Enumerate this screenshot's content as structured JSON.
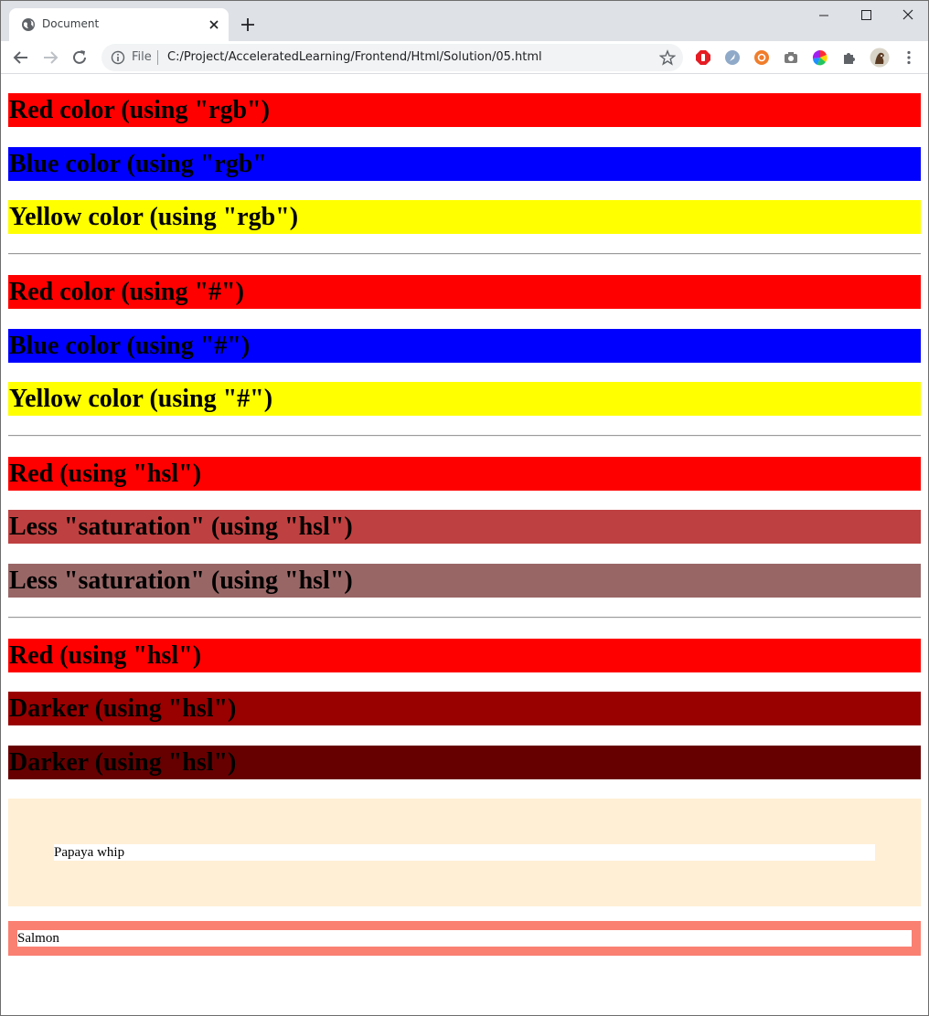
{
  "browser": {
    "tab_title": "Document",
    "url_scheme": "File",
    "url": "C:/Project/AcceleratedLearning/Frontend/Html/Solution/05.html"
  },
  "sections": {
    "rgb": [
      {
        "label": "Red color (using \"rgb\")",
        "color": "#ff0000"
      },
      {
        "label": "Blue color (using \"rgb\"",
        "color": "#0000ff"
      },
      {
        "label": "Yellow color (using \"rgb\")",
        "color": "#ffff00"
      }
    ],
    "hex": [
      {
        "label": "Red color (using \"#\")",
        "color": "#ff0000"
      },
      {
        "label": "Blue color (using \"#\")",
        "color": "#0000ff"
      },
      {
        "label": "Yellow color (using \"#\")",
        "color": "#ffff00"
      }
    ],
    "hsl_saturation": [
      {
        "label": "Red (using \"hsl\")",
        "color": "#ff0000"
      },
      {
        "label": "Less \"saturation\" (using \"hsl\")",
        "color": "#bf4040"
      },
      {
        "label": "Less \"saturation\" (using \"hsl\")",
        "color": "#996666"
      }
    ],
    "hsl_lightness": [
      {
        "label": "Red (using \"hsl\")",
        "color": "#ff0000"
      },
      {
        "label": "Darker (using \"hsl\")",
        "color": "#990000"
      },
      {
        "label": "Darker (using \"hsl\")",
        "color": "#660000"
      }
    ]
  },
  "papaya": {
    "label": "Papaya whip",
    "color": "#ffefd5"
  },
  "salmon": {
    "label": "Salmon",
    "color": "#fa8072"
  }
}
